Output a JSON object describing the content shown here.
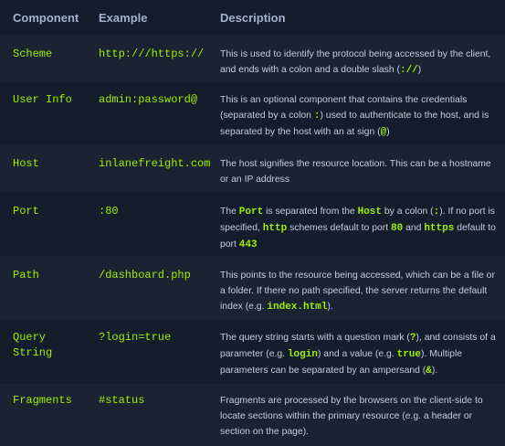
{
  "headers": {
    "component": "Component",
    "example": "Example",
    "description": "Description"
  },
  "rows": [
    {
      "component": "Scheme",
      "example": "http:///https://",
      "description": [
        {
          "t": "This is used to identify the protocol being accessed by the client, and ends with a colon and a double slash ("
        },
        {
          "c": "://"
        },
        {
          "t": ")"
        }
      ]
    },
    {
      "component": "User Info",
      "example": "admin:password@",
      "description": [
        {
          "t": "This is an optional component that contains the credentials (separated by a colon "
        },
        {
          "c": ":"
        },
        {
          "t": ") used to authenticate to the host, and is separated by the host with an at sign ("
        },
        {
          "c": "@"
        },
        {
          "t": ")"
        }
      ]
    },
    {
      "component": "Host",
      "example": "inlanefreight.com",
      "description": [
        {
          "t": "The host signifies the resource location. This can be a hostname or an IP address"
        }
      ]
    },
    {
      "component": "Port",
      "example": ":80",
      "description": [
        {
          "t": "The "
        },
        {
          "c": "Port"
        },
        {
          "t": " is separated from the "
        },
        {
          "c": "Host"
        },
        {
          "t": " by a colon ("
        },
        {
          "c": ":"
        },
        {
          "t": "). If no port is specified, "
        },
        {
          "c": "http"
        },
        {
          "t": " schemes default to port "
        },
        {
          "c": "80"
        },
        {
          "t": " and "
        },
        {
          "c": "https"
        },
        {
          "t": " default to port "
        },
        {
          "c": "443"
        }
      ]
    },
    {
      "component": "Path",
      "example": "/dashboard.php",
      "description": [
        {
          "t": "This points to the resource being accessed, which can be a file or a folder. If there no path specified, the server returns the default index (e.g. "
        },
        {
          "c": "index.html"
        },
        {
          "t": ")."
        }
      ]
    },
    {
      "component": "Query\nString",
      "example": "?login=true",
      "description": [
        {
          "t": "The query string starts with a question mark ("
        },
        {
          "c": "?"
        },
        {
          "t": "), and consists of a parameter (e.g. "
        },
        {
          "c": "login"
        },
        {
          "t": ") and a value (e.g. "
        },
        {
          "c": "true"
        },
        {
          "t": "). Multiple parameters can be separated by an ampersand ("
        },
        {
          "c": "&"
        },
        {
          "t": ")."
        }
      ]
    },
    {
      "component": "Fragments",
      "example": "#status",
      "description": [
        {
          "t": "Fragments are processed by the browsers on the client-side to locate sections within the primary resource (e.g. a header or section on the page)."
        }
      ]
    }
  ]
}
